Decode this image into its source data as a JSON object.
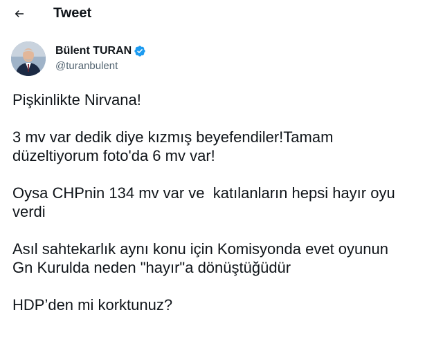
{
  "header": {
    "title": "Tweet",
    "back_icon": "arrow-left-icon"
  },
  "author": {
    "name": "Bülent TURAN",
    "handle": "@turanbulent",
    "verified_color": "#1d9bf0"
  },
  "tweet": {
    "paragraphs": [
      "Pişkinlikte Nirvana!",
      "3 mv var dedik diye kızmış beyefendiler!Tamam\ndüzeltiyorum foto'da 6 mv var!",
      "Oysa CHPnin 134 mv var ve  katılanların hepsi hayır oyu\nverdi",
      "Asıl sahtekarlık aynı konu için Komisyonda evet oyunun\nGn Kurulda neden \"hayır\"a dönüştüğüdür",
      "HDP’den mi korktunuz?"
    ]
  }
}
